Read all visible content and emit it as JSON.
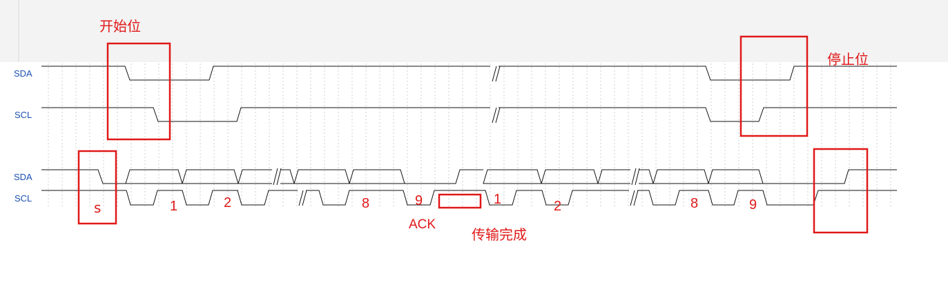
{
  "colors": {
    "annotation": "#e01818",
    "signal_label": "#1a4fb0",
    "wave": "#111111",
    "grid": "#cfcfcf",
    "header": "#f3f3f3"
  },
  "upper": {
    "sda_label": "SDA",
    "scl_label": "SCL"
  },
  "lower": {
    "sda_label": "SDA",
    "scl_label": "SCL",
    "bits_first_byte": [
      "1",
      "2",
      "8",
      "9"
    ],
    "bits_second_byte": [
      "1",
      "2",
      "8",
      "9"
    ]
  },
  "annotations": {
    "start_bit": "开始位",
    "stop_bit": "停止位",
    "start_marker": "s",
    "ack": "ACK",
    "transfer_done": "传输完成"
  }
}
